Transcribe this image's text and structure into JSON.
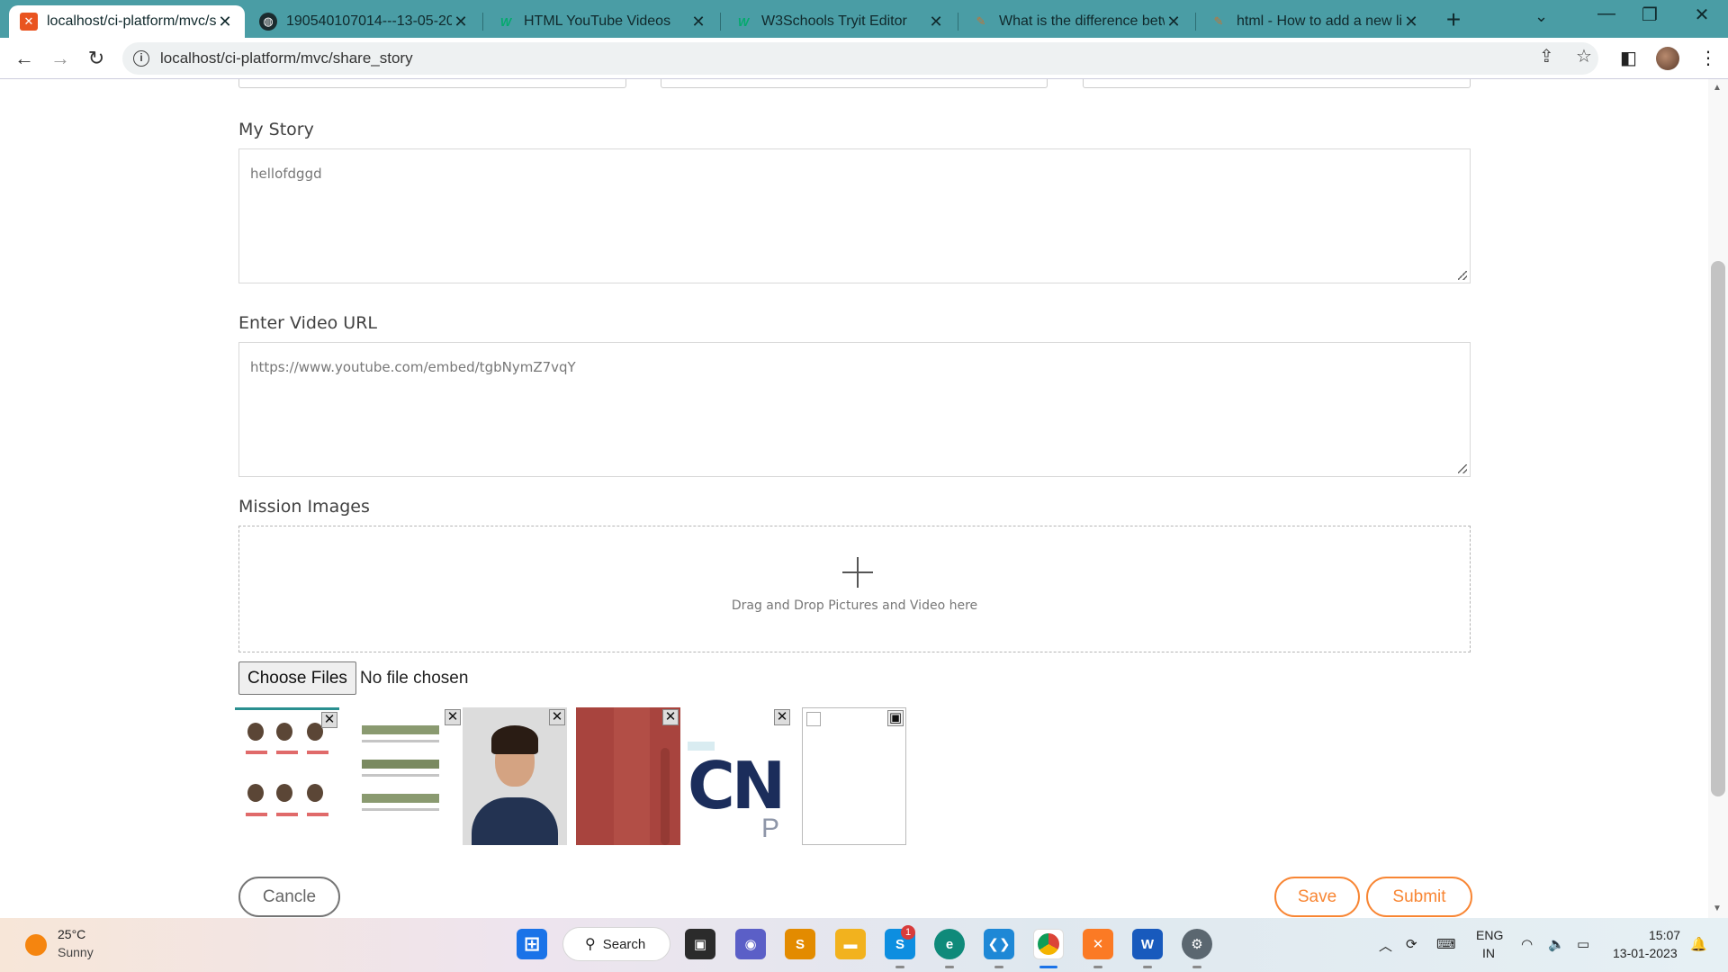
{
  "browser": {
    "tabs": [
      {
        "title": "localhost/ci-platform/mvc/s",
        "icon": "xampp-icon",
        "active": true
      },
      {
        "title": "190540107014---13-05-202",
        "icon": "globe-icon",
        "active": false
      },
      {
        "title": "HTML YouTube Videos",
        "icon": "w3schools-icon",
        "active": false
      },
      {
        "title": "W3Schools Tryit Editor",
        "icon": "w3schools-icon",
        "active": false
      },
      {
        "title": "What is the difference betw",
        "icon": "stackoverflow-icon",
        "active": false
      },
      {
        "title": "html - How to add a new li",
        "icon": "stackoverflow-icon",
        "active": false
      }
    ],
    "url": "localhost/ci-platform/mvc/share_story"
  },
  "form": {
    "story_label": "My Story",
    "story_value": "hellofdggd",
    "video_label": "Enter Video URL",
    "video_value": "https://www.youtube.com/embed/tgbNymZ7vqY",
    "images_label": "Mission Images",
    "dropzone_hint": "Drag and Drop Pictures and Video here",
    "file_button": "Choose Files",
    "file_status": "No file chosen",
    "thumb_close": "✕",
    "thumb_broken_icon": "▣",
    "thumb_logo_text": "CN",
    "thumb_logo_sub": "P"
  },
  "actions": {
    "cancel": "Cancle",
    "save": "Save",
    "submit": "Submit"
  },
  "colors": {
    "tabstrip": "#4a9da5",
    "accent_orange": "#f88634",
    "cancel_gray": "#757575"
  },
  "taskbar": {
    "temp": "25°C",
    "condition": "Sunny",
    "search": "Search",
    "skype_badge": "1",
    "lang_line1": "ENG",
    "lang_line2": "IN",
    "time": "15:07",
    "date": "13-01-2023"
  }
}
